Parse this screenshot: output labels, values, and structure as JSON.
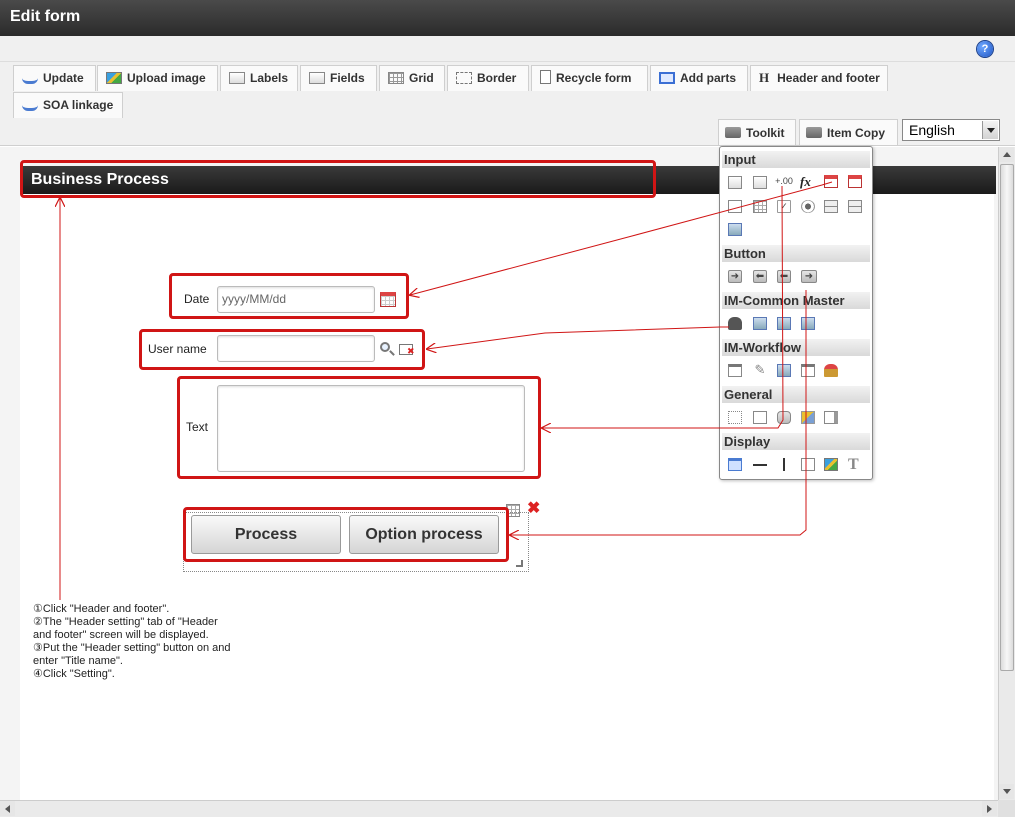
{
  "window": {
    "title": "Edit form"
  },
  "help": {
    "label": "?"
  },
  "tabs": [
    {
      "label": "Update"
    },
    {
      "label": "Upload image"
    },
    {
      "label": "Labels"
    },
    {
      "label": "Fields"
    },
    {
      "label": "Grid"
    },
    {
      "label": "Border"
    },
    {
      "label": "Recycle form"
    },
    {
      "label": "Add parts"
    },
    {
      "label": "Header and footer"
    },
    {
      "label": "SOA linkage"
    }
  ],
  "tools": {
    "toolkit": "Toolkit",
    "item_copy": "Item Copy"
  },
  "language": {
    "selected": "English"
  },
  "header": {
    "title": "Business Process"
  },
  "form": {
    "date_label": "Date",
    "date_placeholder": "yyyy/MM/dd",
    "user_label": "User name",
    "text_label": "Text",
    "process_button": "Process",
    "option_button": "Option process"
  },
  "toolkit": {
    "sections": [
      {
        "title": "Input"
      },
      {
        "title": "Button"
      },
      {
        "title": "IM-Common Master"
      },
      {
        "title": "IM-Workflow"
      },
      {
        "title": "General"
      },
      {
        "title": "Display"
      }
    ],
    "number_glyph": "+.00",
    "fx_glyph": "fx",
    "text_glyph": "T"
  },
  "notes": [
    "①Click \"Header and footer\".",
    "②The \"Header setting\" tab of \"Header",
    "and footer\" screen will be displayed.",
    "③Put the \"Header setting\" button on and",
    "enter \"Title name\".",
    "④Click \"Setting\"."
  ],
  "annotation_color": "#d01515"
}
